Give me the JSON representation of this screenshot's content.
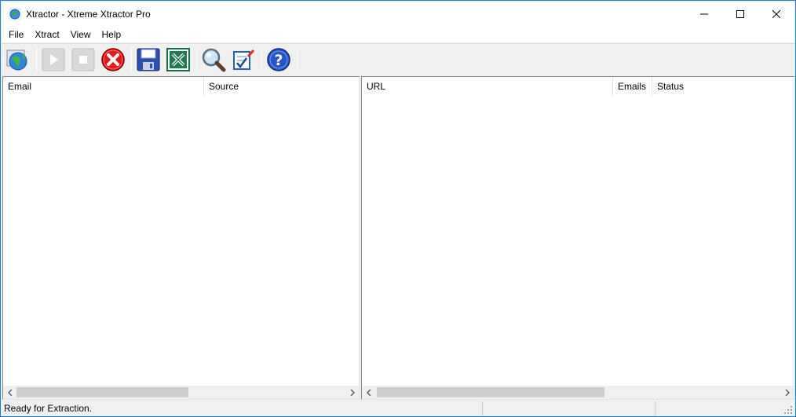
{
  "window": {
    "title": "Xtractor - Xtreme Xtractor Pro",
    "accent_color": "#1e90e6"
  },
  "menu": [
    {
      "label": "File"
    },
    {
      "label": "Xtract"
    },
    {
      "label": "View"
    },
    {
      "label": "Help"
    }
  ],
  "toolbar": {
    "buttons": [
      {
        "icon": "globe-search-icon",
        "enabled": true
      },
      {
        "icon": "play-icon",
        "enabled": false
      },
      {
        "icon": "stop-icon",
        "enabled": false
      },
      {
        "icon": "cancel-icon",
        "enabled": true
      },
      {
        "icon": "save-icon",
        "enabled": true
      },
      {
        "icon": "excel-export-icon",
        "enabled": true
      },
      {
        "icon": "magnifier-icon",
        "enabled": true
      },
      {
        "icon": "checklist-icon",
        "enabled": true
      },
      {
        "icon": "help-icon",
        "enabled": true
      }
    ]
  },
  "left_list": {
    "columns": [
      {
        "label": "Email"
      },
      {
        "label": "Source"
      }
    ],
    "rows": []
  },
  "right_list": {
    "columns": [
      {
        "label": "URL"
      },
      {
        "label": "Emails"
      },
      {
        "label": "Status"
      }
    ],
    "rows": []
  },
  "status": {
    "text": "Ready for Extraction."
  }
}
